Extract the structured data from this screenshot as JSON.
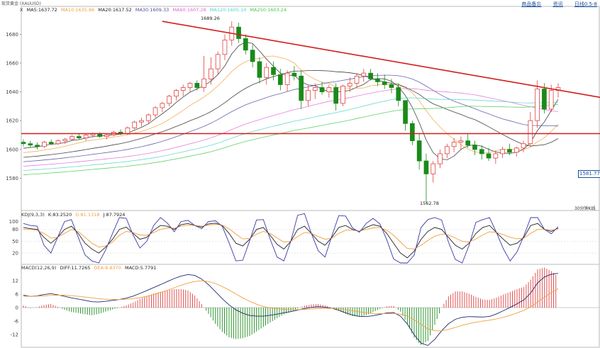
{
  "header": {
    "title": "现货黄金 (XAUUSD)",
    "links": [
      "商品备忘",
      "资讯",
      "日线0.5-8"
    ]
  },
  "legends": {
    "ma": [
      {
        "label": "X",
        "color": "#333333"
      },
      {
        "label": "MA5:1637.72",
        "color": "#222222"
      },
      {
        "label": "MA10:1635.86",
        "color": "#f0a03c"
      },
      {
        "label": "MA20:1617.52",
        "color": "#222222"
      },
      {
        "label": "MA30:1609.33",
        "color": "#4a4aa0"
      },
      {
        "label": "MA60:1607.28",
        "color": "#e066d8"
      },
      {
        "label": "MA120:1605.10",
        "color": "#4fd3c4"
      },
      {
        "label": "MA250:1603.24",
        "color": "#43c94b"
      }
    ],
    "kdj": [
      {
        "label": "KDJ(9,3,3)",
        "color": "#333333"
      },
      {
        "label": "K:83.2520",
        "color": "#222222"
      },
      {
        "label": "D:81.1318",
        "color": "#f0a03c"
      },
      {
        "label": "J:87.7924",
        "color": "#222222"
      }
    ],
    "macd": [
      {
        "label": "MACD(12,26,9)",
        "color": "#333333"
      },
      {
        "label": "DIFF:11.7265",
        "color": "#222222"
      },
      {
        "label": "DEA:8.8370",
        "color": "#f0a03c"
      },
      {
        "label": "MACD:5.7791",
        "color": "#222222"
      }
    ]
  },
  "annotations": {
    "high_label": "1689.26",
    "low_label": "1562.78",
    "interval": "30分钟K线",
    "current_price": "1581.77"
  },
  "chart_data": [
    {
      "type": "candlestick",
      "title": "",
      "yticks": [
        1580,
        1600,
        1620,
        1640,
        1660,
        1680
      ],
      "ylim": [
        1562,
        1692
      ],
      "grid": false,
      "high": 1689.26,
      "low": 1562.78,
      "horizontal_line": 1611,
      "trendline": [
        [
          20,
          1689
        ],
        [
          100,
          1622
        ]
      ],
      "ohlc": [
        [
          1605,
          1607,
          1602,
          1604
        ],
        [
          1604,
          1606,
          1601,
          1603
        ],
        [
          1603,
          1605,
          1600,
          1602
        ],
        [
          1602,
          1606,
          1601,
          1605
        ],
        [
          1605,
          1607,
          1603,
          1604
        ],
        [
          1604,
          1607,
          1603,
          1606
        ],
        [
          1606,
          1608,
          1604,
          1607
        ],
        [
          1607,
          1610,
          1606,
          1609
        ],
        [
          1609,
          1611,
          1607,
          1608
        ],
        [
          1608,
          1611,
          1606,
          1610
        ],
        [
          1610,
          1612,
          1608,
          1611
        ],
        [
          1611,
          1612,
          1608,
          1609
        ],
        [
          1609,
          1611,
          1607,
          1610
        ],
        [
          1610,
          1613,
          1609,
          1612
        ],
        [
          1612,
          1614,
          1610,
          1611
        ],
        [
          1611,
          1616,
          1610,
          1615
        ],
        [
          1615,
          1620,
          1614,
          1619
        ],
        [
          1619,
          1622,
          1616,
          1620
        ],
        [
          1620,
          1625,
          1618,
          1624
        ],
        [
          1624,
          1630,
          1622,
          1629
        ],
        [
          1629,
          1633,
          1626,
          1632
        ],
        [
          1632,
          1638,
          1630,
          1637
        ],
        [
          1637,
          1642,
          1634,
          1641
        ],
        [
          1641,
          1645,
          1637,
          1643
        ],
        [
          1643,
          1647,
          1640,
          1646
        ],
        [
          1646,
          1648,
          1641,
          1643
        ],
        [
          1643,
          1665,
          1640,
          1649
        ],
        [
          1649,
          1664,
          1645,
          1656
        ],
        [
          1656,
          1668,
          1652,
          1666
        ],
        [
          1666,
          1680,
          1662,
          1676
        ],
        [
          1676,
          1689,
          1672,
          1685
        ],
        [
          1685,
          1688,
          1674,
          1677
        ],
        [
          1677,
          1680,
          1666,
          1669
        ],
        [
          1669,
          1673,
          1657,
          1661
        ],
        [
          1661,
          1664,
          1646,
          1650
        ],
        [
          1650,
          1660,
          1645,
          1657
        ],
        [
          1657,
          1661,
          1648,
          1652
        ],
        [
          1652,
          1656,
          1641,
          1645
        ],
        [
          1645,
          1655,
          1640,
          1653
        ],
        [
          1653,
          1658,
          1648,
          1651
        ],
        [
          1651,
          1655,
          1628,
          1634
        ],
        [
          1634,
          1645,
          1630,
          1641
        ],
        [
          1641,
          1646,
          1635,
          1643
        ],
        [
          1643,
          1647,
          1638,
          1640
        ],
        [
          1640,
          1645,
          1636,
          1643
        ],
        [
          1643,
          1646,
          1627,
          1632
        ],
        [
          1632,
          1645,
          1630,
          1644
        ],
        [
          1644,
          1650,
          1640,
          1646
        ],
        [
          1646,
          1653,
          1643,
          1651
        ],
        [
          1651,
          1656,
          1647,
          1653
        ],
        [
          1653,
          1656,
          1648,
          1649
        ],
        [
          1649,
          1653,
          1644,
          1647
        ],
        [
          1647,
          1652,
          1642,
          1645
        ],
        [
          1645,
          1649,
          1639,
          1643
        ],
        [
          1643,
          1646,
          1630,
          1634
        ],
        [
          1634,
          1628,
          1613,
          1618
        ],
        [
          1618,
          1620,
          1603,
          1606
        ],
        [
          1606,
          1611,
          1586,
          1592
        ],
        [
          1592,
          1597,
          1563,
          1583
        ],
        [
          1583,
          1592,
          1577,
          1590
        ],
        [
          1590,
          1600,
          1587,
          1597
        ],
        [
          1597,
          1604,
          1594,
          1602
        ],
        [
          1602,
          1608,
          1598,
          1605
        ],
        [
          1605,
          1609,
          1600,
          1606
        ],
        [
          1606,
          1611,
          1601,
          1603
        ],
        [
          1603,
          1606,
          1596,
          1600
        ],
        [
          1600,
          1603,
          1593,
          1597
        ],
        [
          1597,
          1601,
          1592,
          1594
        ],
        [
          1594,
          1599,
          1590,
          1597
        ],
        [
          1597,
          1602,
          1594,
          1600
        ],
        [
          1600,
          1604,
          1596,
          1598
        ],
        [
          1598,
          1602,
          1595,
          1601
        ],
        [
          1601,
          1606,
          1598,
          1604
        ],
        [
          1604,
          1626,
          1602,
          1620
        ],
        [
          1620,
          1648,
          1615,
          1642
        ],
        [
          1642,
          1646,
          1625,
          1628
        ],
        [
          1628,
          1645,
          1626,
          1641
        ],
        [
          1641,
          1646,
          1636,
          1643
        ]
      ]
    },
    {
      "type": "line",
      "title": "",
      "yticks": [
        20,
        50,
        80,
        100
      ],
      "ylim": [
        -5,
        110
      ],
      "series": [
        {
          "values": [
            85,
            82,
            80,
            60,
            45,
            60,
            80,
            88,
            70,
            45,
            30,
            20,
            35,
            55,
            80,
            86,
            70,
            55,
            60,
            78,
            90,
            88,
            80,
            92,
            95,
            90,
            86,
            94,
            96,
            90,
            70,
            45,
            38,
            55,
            80,
            85,
            65,
            42,
            30,
            50,
            80,
            88,
            70,
            50,
            40,
            60,
            85,
            90,
            80,
            75,
            85,
            92,
            88,
            70,
            45,
            20,
            8,
            25,
            55,
            75,
            85,
            80,
            60,
            40,
            30,
            45,
            70,
            85,
            90,
            72,
            55,
            40,
            45,
            60,
            90,
            95,
            80,
            75,
            83
          ]
        },
        {
          "values": [
            80,
            80,
            78,
            70,
            58,
            60,
            70,
            80,
            75,
            60,
            45,
            35,
            38,
            48,
            65,
            75,
            72,
            66,
            65,
            72,
            80,
            84,
            83,
            88,
            91,
            90,
            88,
            91,
            93,
            91,
            82,
            68,
            56,
            57,
            68,
            75,
            70,
            58,
            48,
            50,
            62,
            72,
            70,
            62,
            55,
            58,
            70,
            78,
            78,
            76,
            80,
            84,
            85,
            78,
            65,
            48,
            32,
            30,
            40,
            52,
            63,
            68,
            66,
            58,
            50,
            48,
            56,
            66,
            74,
            72,
            67,
            60,
            56,
            58,
            70,
            80,
            80,
            78,
            81
          ]
        },
        {
          "values": [
            95,
            90,
            88,
            40,
            20,
            60,
            100,
            105,
            60,
            15,
            0,
            -5,
            28,
            70,
            110,
            108,
            66,
            33,
            50,
            90,
            110,
            96,
            74,
            100,
            103,
            90,
            82,
            100,
            102,
            88,
            46,
            0,
            2,
            51,
            104,
            105,
            55,
            10,
            0,
            50,
            116,
            120,
            70,
            26,
            10,
            64,
            115,
            114,
            84,
            73,
            95,
            108,
            94,
            54,
            5,
            -5,
            -5,
            15,
            85,
            105,
            110,
            104,
            48,
            4,
            -5,
            39,
            98,
            105,
            110,
            72,
            31,
            0,
            23,
            64,
            110,
            110,
            80,
            69,
            87
          ]
        }
      ]
    },
    {
      "type": "bar+line",
      "title": "",
      "yticks": [
        -12,
        -6,
        0,
        6,
        12
      ],
      "ylim": [
        -17,
        17
      ],
      "diff": [
        5.5,
        5.0,
        5.2,
        5.8,
        6.2,
        5.7,
        5.0,
        4.3,
        3.8,
        3.2,
        2.6,
        2.5,
        2.8,
        3.2,
        3.6,
        4.2,
        5.1,
        6.3,
        7.6,
        8.9,
        10.2,
        11.6,
        12.9,
        14.0,
        14.7,
        14.3,
        12.7,
        10.2,
        7.1,
        4.0,
        1.2,
        -1.0,
        -2.5,
        -3.5,
        -3.8,
        -3.8,
        -3.4,
        -2.9,
        -2.3,
        -1.8,
        -1.1,
        -0.4,
        0.1,
        0.4,
        0.2,
        -0.3,
        -1.2,
        -2.3,
        -3.3,
        -3.9,
        -4.0,
        -3.6,
        -3.0,
        -2.4,
        -2.2,
        -3.8,
        -7.3,
        -12.1,
        -15.8,
        -16.8,
        -14.1,
        -10.3,
        -7.2,
        -5.2,
        -4.3,
        -4.0,
        -4.1,
        -4.2,
        -3.9,
        -2.8,
        -1.4,
        0.1,
        1.7,
        3.4,
        6.5,
        11.0,
        13.6,
        14.8,
        15.2
      ],
      "dea": [
        5.0,
        5.1,
        5.1,
        5.2,
        5.4,
        5.5,
        5.5,
        5.3,
        5.0,
        4.7,
        4.3,
        3.9,
        3.7,
        3.6,
        3.6,
        3.7,
        4.0,
        4.4,
        5.0,
        5.8,
        6.7,
        7.7,
        8.8,
        9.9,
        10.9,
        11.6,
        11.9,
        11.6,
        10.7,
        9.4,
        7.8,
        6.0,
        4.3,
        2.8,
        1.5,
        0.5,
        -0.1,
        -0.5,
        -0.8,
        -0.9,
        -0.9,
        -0.8,
        -0.6,
        -0.4,
        -0.3,
        -0.3,
        -0.5,
        -0.9,
        -1.4,
        -1.9,
        -2.3,
        -2.6,
        -2.7,
        -2.7,
        -2.6,
        -2.9,
        -3.7,
        -5.4,
        -7.5,
        -9.4,
        -10.3,
        -10.3,
        -9.7,
        -8.8,
        -7.9,
        -7.1,
        -6.5,
        -6.0,
        -5.6,
        -5.0,
        -4.3,
        -3.4,
        -2.4,
        -1.2,
        0.3,
        2.5,
        4.7,
        6.7,
        8.4
      ]
    }
  ]
}
